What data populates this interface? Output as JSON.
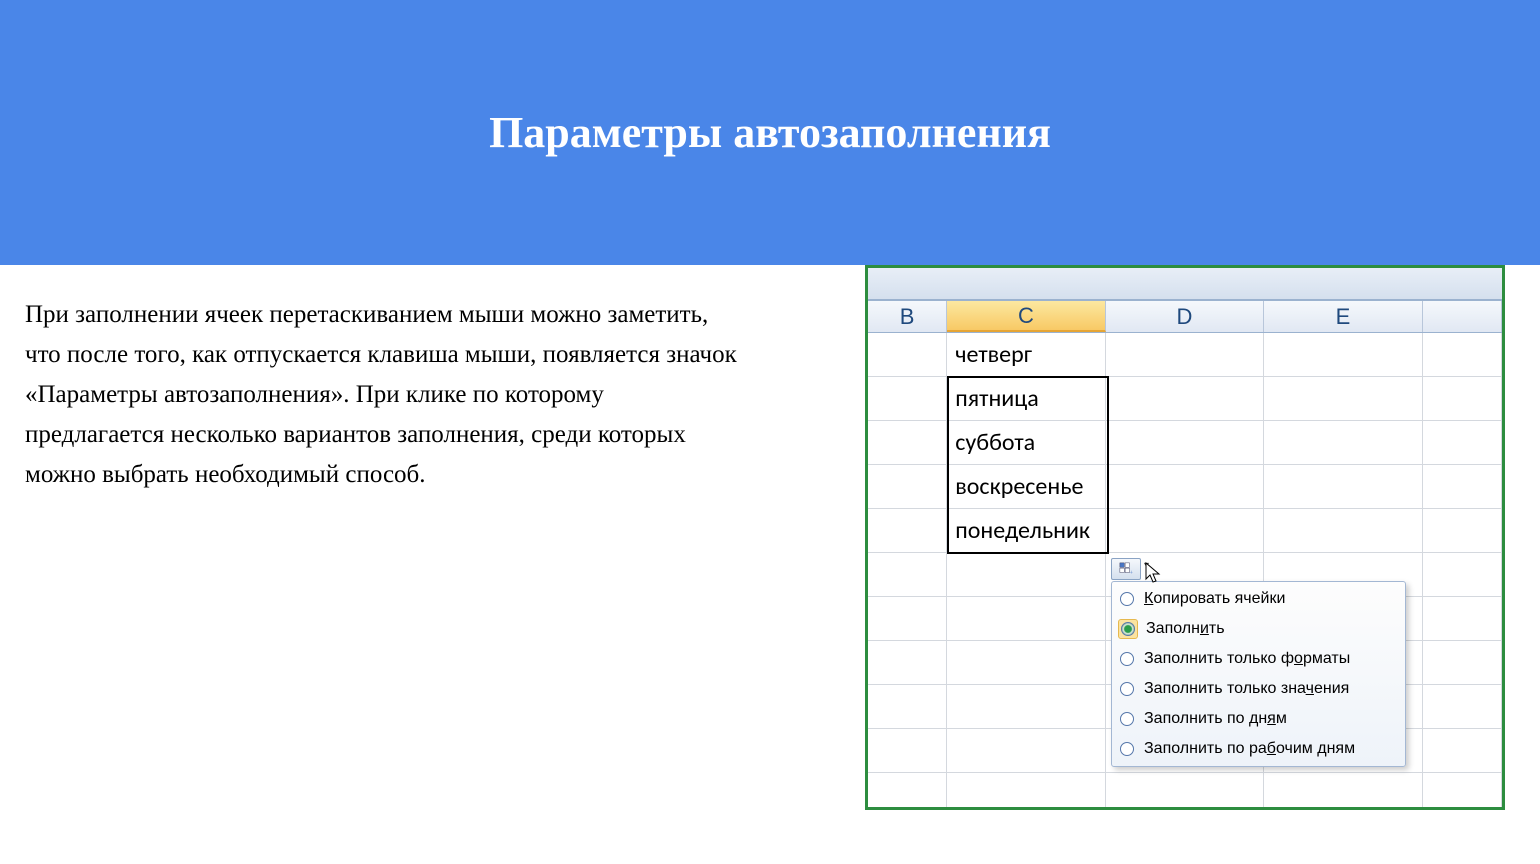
{
  "header": {
    "title": "Параметры автозаполнения"
  },
  "body_text": "При заполнении ячеек перетаскиванием мыши можно заметить, что после того, как отпускается клавиша мыши, появляется значок «Параметры автозаполнения». При клике по которому предлагается несколько вариантов заполнения, среди которых можно выбрать необходимый способ.",
  "cols": {
    "B": "B",
    "C": "C",
    "D": "D",
    "E": "E"
  },
  "cells": {
    "r1": "четверг",
    "r2": "пятница",
    "r3": "суббота",
    "r4": "воскресенье",
    "r5": "понедельник"
  },
  "menu": {
    "items": [
      {
        "label_pre": "",
        "u": "К",
        "label_post": "опировать ячейки",
        "selected": false
      },
      {
        "label_pre": "Заполн",
        "u": "и",
        "label_post": "ть",
        "selected": true
      },
      {
        "label_pre": "Заполнить только ф",
        "u": "о",
        "label_post": "рматы",
        "selected": false
      },
      {
        "label_pre": "Заполнить только зна",
        "u": "ч",
        "label_post": "ения",
        "selected": false
      },
      {
        "label_pre": "Заполнить по дн",
        "u": "я",
        "label_post": "м",
        "selected": false
      },
      {
        "label_pre": "Заполнить по ра",
        "u": "б",
        "label_post": "очим дням",
        "selected": false
      }
    ]
  }
}
